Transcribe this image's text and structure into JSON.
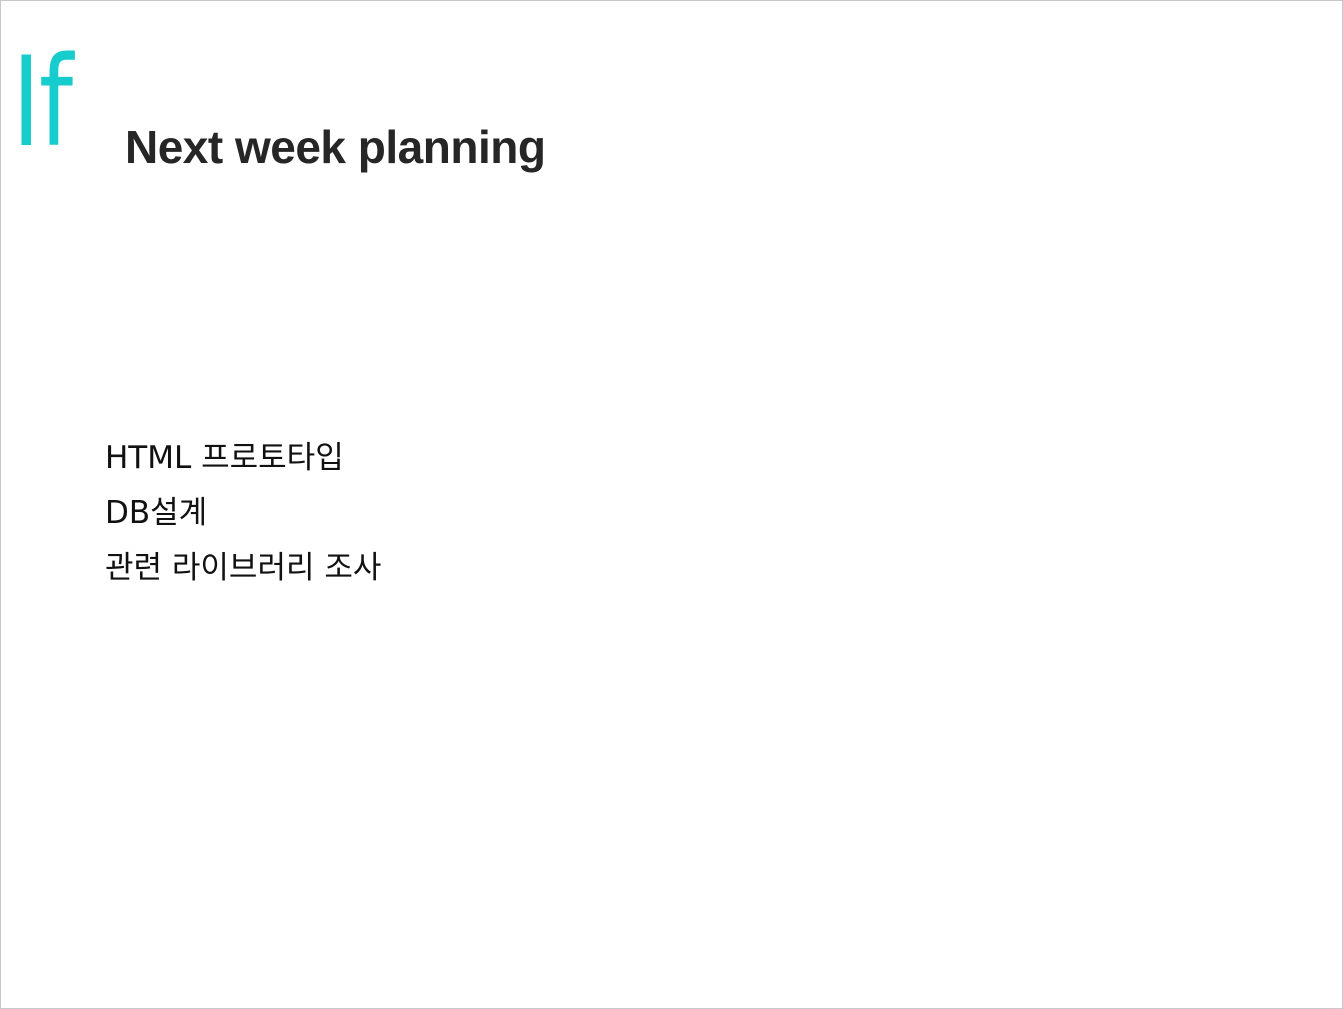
{
  "slide": {
    "logo_text": "If",
    "title": "Next week planning",
    "items": [
      "HTML 프로토타입",
      "DB설계",
      "관련 라이브러리 조사"
    ]
  },
  "colors": {
    "accent": "#17cccc",
    "title": "#262626",
    "text": "#111111"
  }
}
